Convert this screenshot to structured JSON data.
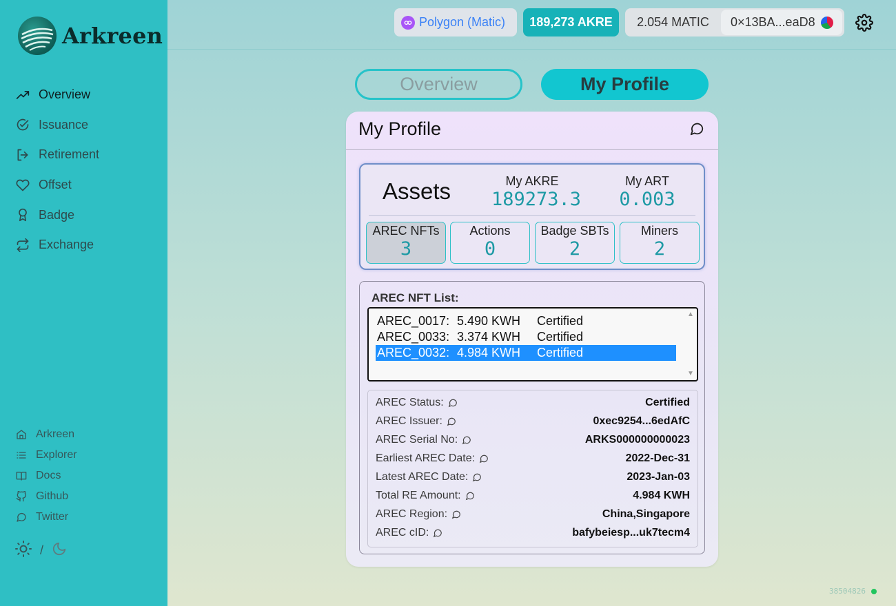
{
  "brand": {
    "name": "Arkreen"
  },
  "sidebar": {
    "nav": [
      {
        "label": "Overview",
        "icon": "trending-up-icon"
      },
      {
        "label": "Issuance",
        "icon": "check-circle-icon"
      },
      {
        "label": "Retirement",
        "icon": "log-out-icon"
      },
      {
        "label": "Offset",
        "icon": "heart-icon"
      },
      {
        "label": "Badge",
        "icon": "award-icon"
      },
      {
        "label": "Exchange",
        "icon": "repeat-icon"
      }
    ],
    "links": [
      {
        "label": "Arkreen",
        "icon": "home-icon"
      },
      {
        "label": "Explorer",
        "icon": "list-icon"
      },
      {
        "label": "Docs",
        "icon": "book-icon"
      },
      {
        "label": "Github",
        "icon": "github-icon"
      },
      {
        "label": "Twitter",
        "icon": "chat-icon"
      }
    ],
    "theme_sep": "/"
  },
  "header": {
    "network": "Polygon (Matic)",
    "akre_balance": "189,273 AKRE",
    "matic_balance": "2.054 MATIC",
    "address": "0×13BA...eaD8"
  },
  "tabs": {
    "overview": "Overview",
    "profile": "My Profile"
  },
  "card": {
    "title": "My Profile",
    "assets": {
      "title": "Assets",
      "akre_label": "My AKRE",
      "akre_value": "189273.3",
      "art_label": "My ART",
      "art_value": "0.003",
      "tiles": [
        {
          "label": "AREC NFTs",
          "value": "3"
        },
        {
          "label": "Actions",
          "value": "0"
        },
        {
          "label": "Badge SBTs",
          "value": "2"
        },
        {
          "label": "Miners",
          "value": "2"
        }
      ]
    },
    "nft_list": {
      "label": "AREC NFT List:",
      "items": [
        {
          "id": "AREC_0017:",
          "amount": "5.490 KWH",
          "status": "Certified"
        },
        {
          "id": "AREC_0033:",
          "amount": "3.374 KWH",
          "status": "Certified"
        },
        {
          "id": "AREC_0032:",
          "amount": "4.984 KWH",
          "status": "Certified"
        }
      ]
    },
    "details": [
      {
        "label": "AREC Status:",
        "value": "Certified"
      },
      {
        "label": "AREC Issuer:",
        "value": "0xec9254...6edAfC"
      },
      {
        "label": "AREC Serial No:",
        "value": "ARKS000000000023"
      },
      {
        "label": "Earliest AREC Date:",
        "value": "2022-Dec-31"
      },
      {
        "label": "Latest AREC Date:",
        "value": "2023-Jan-03"
      },
      {
        "label": "Total RE Amount:",
        "value": "4.984 KWH"
      },
      {
        "label": "AREC Region:",
        "value": "China,Singapore"
      },
      {
        "label": "AREC cID:",
        "value": "bafybeiesp...uk7tecm4"
      }
    ]
  },
  "footer": {
    "block_number": "38504826"
  },
  "colors": {
    "sidebar": "#2fbfc4",
    "accent": "#12c6d0",
    "value": "#1e9aa5",
    "selected": "#1e90ff"
  }
}
